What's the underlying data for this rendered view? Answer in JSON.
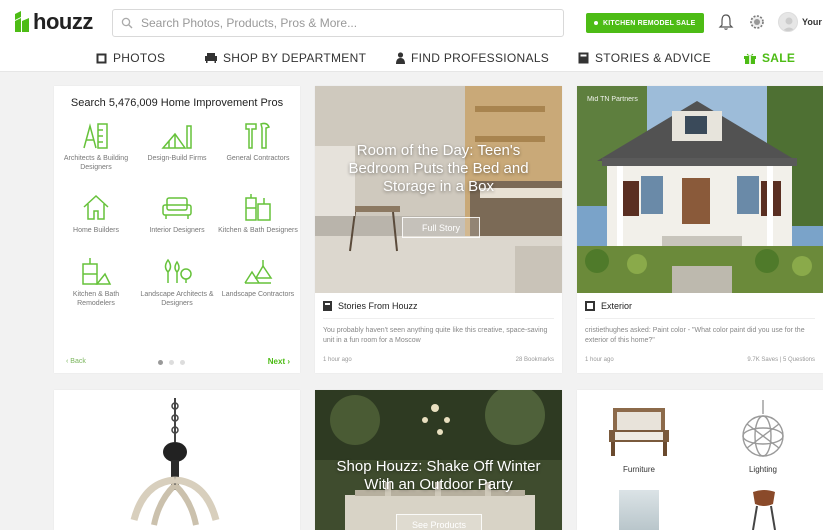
{
  "header": {
    "logo_text": "houzz",
    "search_placeholder": "Search Photos, Products, Pros & More...",
    "sale_button": "KITCHEN REMODEL SALE",
    "user_label": "Your",
    "brand_color": "#4dbc15"
  },
  "nav": {
    "photos": "PHOTOS",
    "shop": "SHOP BY DEPARTMENT",
    "find_pros": "FIND PROFESSIONALS",
    "stories": "STORIES & ADVICE",
    "sale": "SALE"
  },
  "pros_card": {
    "title": "Search 5,476,009 Home Improvement Pros",
    "categories": [
      {
        "label": "Architects & Building Designers",
        "icon": "architect-icon"
      },
      {
        "label": "Design-Build Firms",
        "icon": "design-build-icon"
      },
      {
        "label": "General Contractors",
        "icon": "contractor-tools-icon"
      },
      {
        "label": "Home Builders",
        "icon": "house-icon"
      },
      {
        "label": "Interior Designers",
        "icon": "sofa-icon"
      },
      {
        "label": "Kitchen & Bath Designers",
        "icon": "kitchen-icon"
      },
      {
        "label": "Kitchen & Bath Remodelers",
        "icon": "remodel-icon"
      },
      {
        "label": "Landscape Architects & Designers",
        "icon": "landscape-icon"
      },
      {
        "label": "Landscape Contractors",
        "icon": "landscape-contractor-icon"
      }
    ],
    "back": "‹ Back",
    "next": "Next ›"
  },
  "story_card": {
    "title": "Room of the Day: Teen's Bedroom Puts the Bed and Storage in a Box",
    "button": "Full Story",
    "source": "Stories From Houzz",
    "description": "You probably haven't seen anything quite like this creative, space-saving unit in a fun room for a Moscow",
    "time": "1 hour ago",
    "stat": "28 Bookmarks"
  },
  "exterior_card": {
    "credit": "Mid TN Partners",
    "category": "Exterior",
    "description": "cristiethughes asked: Paint color - \"What color paint did you use for the exterior of this home?\"",
    "time": "1 hour ago",
    "stat": "9.7K Saves | 5 Questions"
  },
  "shop_card": {
    "title": "Shop Houzz: Shake Off Winter With an Outdoor Party",
    "button": "See Products"
  },
  "categories_card": {
    "furniture": "Furniture",
    "lighting": "Lighting"
  }
}
